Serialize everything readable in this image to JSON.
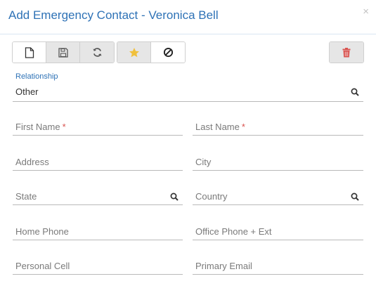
{
  "dialog": {
    "title": "Add Emergency Contact - Veronica Bell",
    "close_glyph": "×"
  },
  "toolbar": {
    "icons": [
      "new-document-icon",
      "save-icon",
      "refresh-icon",
      "star-icon",
      "ban-icon",
      "trash-icon"
    ],
    "star_color": "#f0c03c",
    "trash_color": "#d9534f"
  },
  "relationship": {
    "label": "Relationship",
    "value": "Other"
  },
  "fields": {
    "first_name": "First Name",
    "last_name": "Last Name",
    "address": "Address",
    "city": "City",
    "state": "State",
    "country": "Country",
    "home_phone": "Home Phone",
    "office_phone": "Office Phone + Ext",
    "personal_cell": "Personal Cell",
    "primary_email": "Primary Email",
    "required_mark": "*"
  },
  "colors": {
    "accent": "#2e72b6",
    "required": "#d9534f"
  }
}
